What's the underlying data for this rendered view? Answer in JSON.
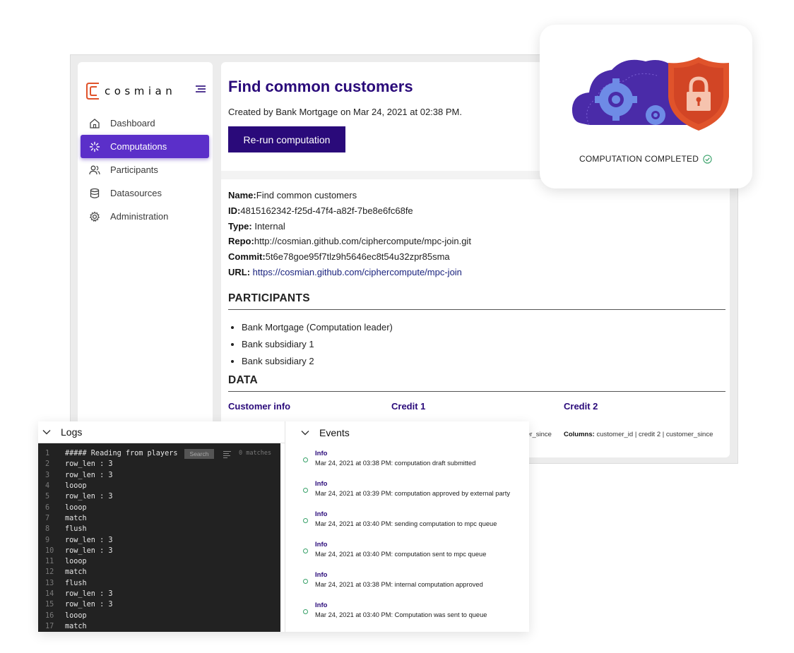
{
  "brand": {
    "name": "cosmian"
  },
  "sidebar": {
    "items": [
      {
        "label": "Dashboard",
        "icon": "home-icon"
      },
      {
        "label": "Computations",
        "icon": "spinner-icon",
        "active": true
      },
      {
        "label": "Participants",
        "icon": "users-icon"
      },
      {
        "label": "Datasources",
        "icon": "database-icon"
      },
      {
        "label": "Administration",
        "icon": "gear-icon"
      }
    ]
  },
  "computation": {
    "title": "Find common customers",
    "created": "Created by Bank Mortgage on Mar 24, 2021 at 02:38 PM.",
    "rerun_label": "Re-run computation",
    "fields": {
      "name_label": "Name:",
      "name": "Find common customers",
      "id_label": "ID:",
      "id": "4815162342-f25d-47f4-a82f-7be8e6fc68fe",
      "type_label": "Type:",
      "type": "Internal",
      "repo_label": "Repo:",
      "repo": "http://cosmian.github.com/ciphercompute/mpc-join.git",
      "commit_label": "Commit:",
      "commit": "5t6e78goe95f7tlz9h5646ec8t54u32zpr85sma",
      "url_label": "URL:",
      "url": "https://cosmian.github.com/ciphercompute/mpc-join"
    }
  },
  "participants": {
    "heading": "PARTICIPANTS",
    "items": [
      "Bank Mortgage (Computation leader)",
      "Bank subsidiary 1",
      "Bank subsidiary 2"
    ]
  },
  "data_section": {
    "heading": "DATA",
    "columns": [
      {
        "title": "Customer info"
      },
      {
        "title": "Credit 1",
        "columns_tail": "er_since"
      },
      {
        "title": "Credit 2",
        "columns_label": "Columns:",
        "columns_value": "customer_id | credit 2 | customer_since"
      }
    ]
  },
  "status": {
    "label": "COMPUTATION COMPLETED"
  },
  "logs": {
    "heading": "Logs",
    "search_placeholder": "Search",
    "matches": "0 matches",
    "lines": [
      {
        "n": "1",
        "text": "##### Reading from players"
      },
      {
        "n": "2",
        "text": "row_len : 3"
      },
      {
        "n": "3",
        "text": "row_len : 3"
      },
      {
        "n": "4",
        "text": "looop"
      },
      {
        "n": "5",
        "text": "row_len : 3"
      },
      {
        "n": "6",
        "text": "looop"
      },
      {
        "n": "7",
        "text": "match"
      },
      {
        "n": "8",
        "text": "flush"
      },
      {
        "n": "9",
        "text": "row_len : 3"
      },
      {
        "n": "10",
        "text": "row_len : 3"
      },
      {
        "n": "11",
        "text": "looop"
      },
      {
        "n": "12",
        "text": "match"
      },
      {
        "n": "13",
        "text": "flush"
      },
      {
        "n": "14",
        "text": "row_len : 3"
      },
      {
        "n": "15",
        "text": "row_len : 3"
      },
      {
        "n": "16",
        "text": "looop"
      },
      {
        "n": "17",
        "text": "match"
      }
    ]
  },
  "events": {
    "heading": "Events",
    "items": [
      {
        "level": "Info",
        "message": "Mar 24, 2021 at 03:38 PM: computation draft submitted"
      },
      {
        "level": "Info",
        "message": "Mar 24, 2021 at 03:39 PM: computation approved by external party"
      },
      {
        "level": "Info",
        "message": "Mar 24, 2021 at 03:40 PM: sending computation to mpc queue"
      },
      {
        "level": "Info",
        "message": "Mar 24, 2021 at 03:40 PM: computation sent to mpc queue"
      },
      {
        "level": "Info",
        "message": "Mar 24, 2021 at 03:38 PM: internal computation approved"
      },
      {
        "level": "Info",
        "message": "Mar 24, 2021 at 03:40 PM: Computation was sent to queue"
      }
    ]
  },
  "colors": {
    "brand_purple": "#2a0a7a",
    "active_nav": "#5b2fc9",
    "logo_orange": "#e0532b",
    "success": "#38a169"
  }
}
